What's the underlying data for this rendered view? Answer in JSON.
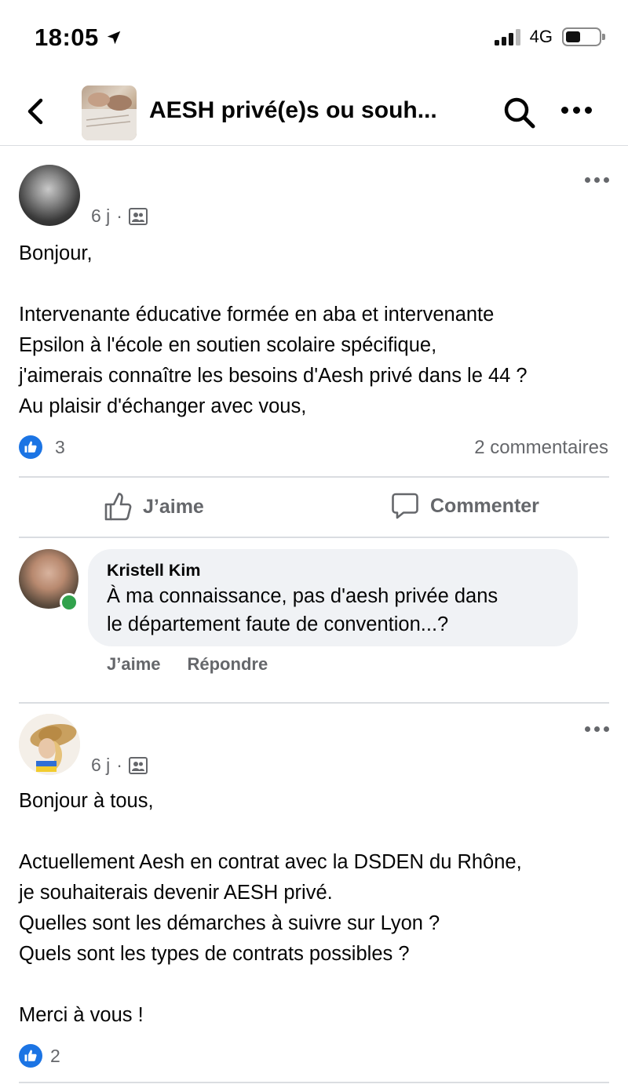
{
  "status_bar": {
    "time": "18:05",
    "network": "4G"
  },
  "header": {
    "title": "AESH privé(e)s ou souh..."
  },
  "posts": [
    {
      "time": "6 j",
      "separator": "·",
      "body": [
        "Bonjour,",
        "",
        "Intervenante éducative formée en aba et intervenante",
        "Epsilon à l'école en soutien scolaire spécifique,",
        "j'aimerais connaître les besoins d'Aesh privé dans le 44 ?",
        "Au plaisir d'échanger avec vous,"
      ],
      "reaction_count": "3",
      "comments_count": "2 commentaires",
      "like_label": "J’aime",
      "comment_label": "Commenter"
    },
    {
      "time": "6 j",
      "separator": "·",
      "body": [
        "Bonjour à tous,",
        "",
        "Actuellement Aesh en contrat avec la DSDEN du Rhône,",
        "je souhaiterais devenir AESH privé.",
        "Quelles sont les démarches à suivre sur Lyon ?",
        "Quels sont les types de contrats possibles ?",
        "",
        "Merci à vous !"
      ],
      "reaction_count": "2"
    }
  ],
  "comment": {
    "author": "Kristell Kim",
    "text_line1": "À ma connaissance, pas d'aesh privée dans",
    "text_line2": "le département faute de convention...?",
    "like_label": "J’aime",
    "reply_label": "Répondre"
  },
  "colors": {
    "like_blue": "#1b74e4",
    "online_green": "#31a24c",
    "secondary_text": "#65676b",
    "bubble_bg": "#f0f2f5"
  },
  "icons": {
    "back": "chevron-left-icon",
    "search": "search-icon",
    "more": "more-dots-icon",
    "audience": "group-members-icon",
    "like": "thumbs-up-icon",
    "comment": "comment-bubble-icon"
  }
}
